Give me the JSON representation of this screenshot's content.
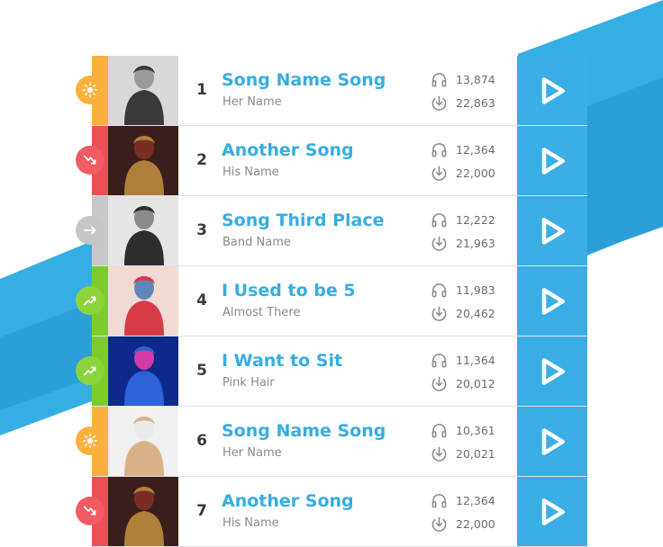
{
  "colors": {
    "accent": "#36ade2",
    "play_bg": "#3aaee5",
    "background_shape": "#35aee4"
  },
  "songs": [
    {
      "rank": "1",
      "title": "Song Name Song",
      "artist": "Her Name",
      "plays": "13,874",
      "downloads": "22,863",
      "trend_icon": "sun-icon",
      "trend_color": "#fbb13c",
      "stripe_color": "#fbb13c",
      "cover_colors": [
        "#d8d8d8",
        "#3a3a3a",
        "#9a9a9a"
      ]
    },
    {
      "rank": "2",
      "title": "Another Song",
      "artist": "His Name",
      "plays": "12,364",
      "downloads": "22,000",
      "trend_icon": "trend-down-icon",
      "trend_color": "#f25b63",
      "stripe_color": "#ec4f56",
      "cover_colors": [
        "#3b1f1c",
        "#b07f3a",
        "#7a2e22"
      ]
    },
    {
      "rank": "3",
      "title": "Song Third Place",
      "artist": "Band Name",
      "plays": "12,222",
      "downloads": "21,963",
      "trend_icon": "arrow-right-icon",
      "trend_color": "#c6c6c6",
      "stripe_color": "#c8c8c8",
      "cover_colors": [
        "#e5e5e5",
        "#2e2e2e",
        "#8b8b8b"
      ]
    },
    {
      "rank": "4",
      "title": "I Used to be 5",
      "artist": "Almost There",
      "plays": "11,983",
      "downloads": "20,462",
      "trend_icon": "trend-up-icon",
      "trend_color": "#8cd43b",
      "stripe_color": "#7dcc2c",
      "cover_colors": [
        "#f3d9d4",
        "#d63a47",
        "#5c87b8"
      ]
    },
    {
      "rank": "5",
      "title": "I Want to Sit",
      "artist": "Pink Hair",
      "plays": "11,364",
      "downloads": "20,012",
      "trend_icon": "trend-up-icon",
      "trend_color": "#8cd43b",
      "stripe_color": "#7dcc2c",
      "cover_colors": [
        "#0d2a8a",
        "#2c63d6",
        "#d43aa8"
      ]
    },
    {
      "rank": "6",
      "title": "Song Name Song",
      "artist": "Her Name",
      "plays": "10,361",
      "downloads": "20,021",
      "trend_icon": "sun-icon",
      "trend_color": "#fbb13c",
      "stripe_color": "#fbb13c",
      "cover_colors": [
        "#f1f1f1",
        "#d9b28a",
        "#eaeaea"
      ]
    },
    {
      "rank": "7",
      "title": "Another Song",
      "artist": "His Name",
      "plays": "12,364",
      "downloads": "22,000",
      "trend_icon": "trend-down-icon",
      "trend_color": "#f25b63",
      "stripe_color": "#ec4f56",
      "cover_colors": [
        "#3b1f1c",
        "#b07f3a",
        "#7a2e22"
      ]
    }
  ]
}
